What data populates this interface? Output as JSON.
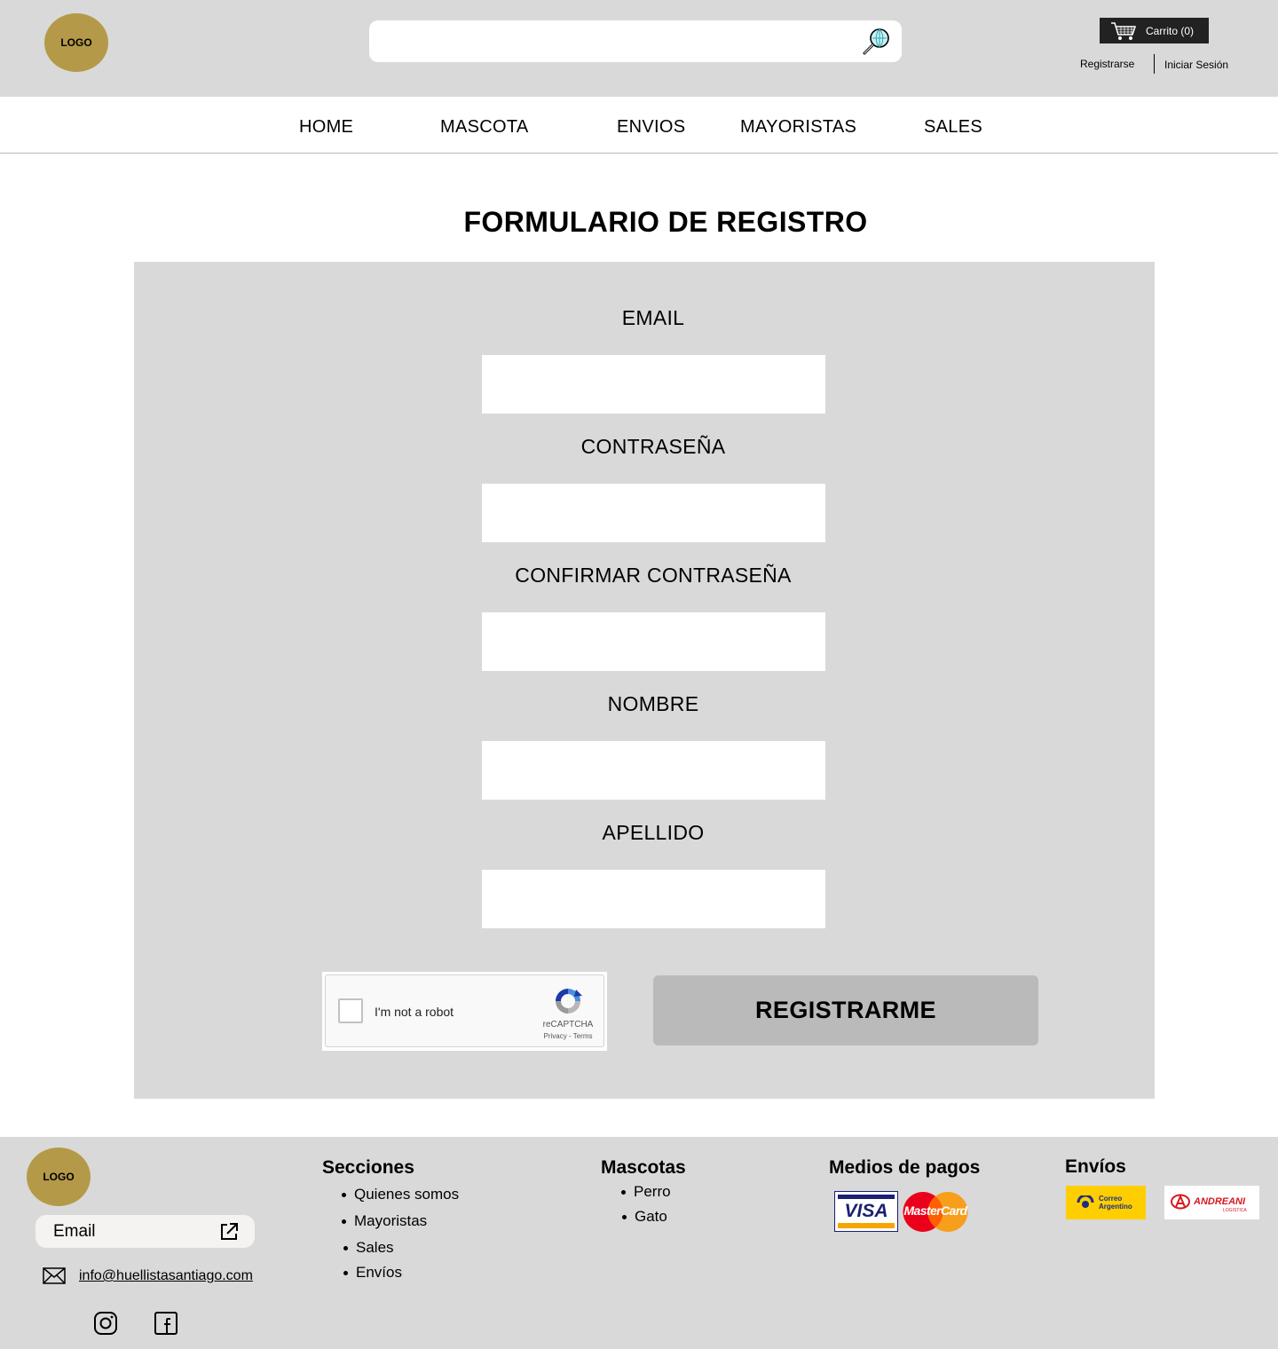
{
  "header": {
    "logo_text": "LOGO",
    "search": {
      "value": "",
      "placeholder": ""
    },
    "cart_label": "Carrito (0)",
    "register_label": "Registrarse",
    "login_label": "Iniciar Sesión"
  },
  "nav": {
    "items": [
      {
        "label": "HOME"
      },
      {
        "label": "MASCOTA"
      },
      {
        "label": "ENVIOS"
      },
      {
        "label": "MAYORISTAS"
      },
      {
        "label": "SALES"
      }
    ]
  },
  "form": {
    "title": "FORMULARIO DE REGISTRO",
    "fields": [
      {
        "label": "EMAIL",
        "value": ""
      },
      {
        "label": "CONTRASEÑA",
        "value": ""
      },
      {
        "label": "CONFIRMAR CONTRASEÑA",
        "value": ""
      },
      {
        "label": "NOMBRE",
        "value": ""
      },
      {
        "label": "APELLIDO",
        "value": ""
      }
    ],
    "captcha": {
      "label": "I'm not a robot",
      "brand": "reCAPTCHA",
      "links": "Privacy - Terms"
    },
    "submit_label": "REGISTRARME"
  },
  "footer": {
    "logo_text": "LOGO",
    "email_label": "Email",
    "contact_email": "info@huellistasantiago.com",
    "sections": {
      "title": "Secciones",
      "items": [
        "Quienes somos",
        "Mayoristas",
        "Sales",
        "Envíos"
      ]
    },
    "pets": {
      "title": "Mascotas",
      "items": [
        "Perro",
        "Gato"
      ]
    },
    "payments": {
      "title": "Medios de pagos",
      "visa_text": "VISA",
      "mastercard_text": "MasterCard"
    },
    "shipping": {
      "title": "Envíos",
      "correo_text_1": "Correo",
      "correo_text_2": "Argentino",
      "andreani_text": "ANDREANI",
      "andreani_sub": "LOGISTICA"
    }
  },
  "colors": {
    "header_bg": "#d9d9d9",
    "logo_gold": "#b49a48",
    "cart_bg": "#222222",
    "panel_bg": "#d9d9d9",
    "button_bg": "#bababa"
  }
}
